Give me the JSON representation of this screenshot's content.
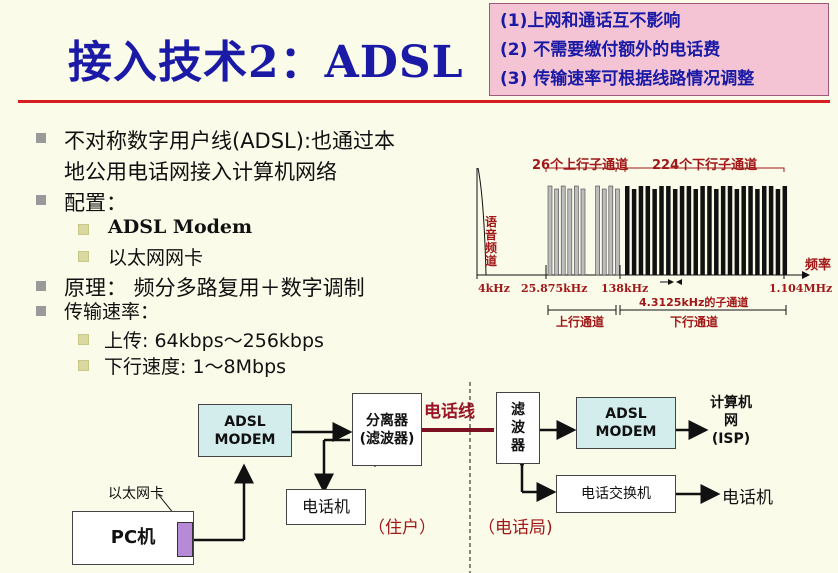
{
  "title": "接入技术2：ADSL",
  "callout": [
    "(1)上网和通话互不影响",
    "(2) 不需要缴付额外的电话费",
    "(3) 传输速率可根据线路情况调整"
  ],
  "bullets": {
    "adsl_line1": "不对称数字用户线(ADSL):也通过本",
    "adsl_line2": "地公用电话网接入计算机网络",
    "config": "配置：",
    "config_items": [
      "ADSL Modem",
      "以太网网卡"
    ],
    "principle": "原理：  频分多路复用＋数字调制",
    "rate": "传输速率：",
    "rate_items": [
      "上传: 64kbps～256kbps",
      "下行速度: 1～8Mbps"
    ]
  },
  "spectrum": {
    "voice_label": "语音频道",
    "up_channels_label": "26个上行子通道",
    "down_channels_label": "224个下行子通道",
    "axis_label": "频率",
    "ticks": [
      "4kHz",
      "25.875kHz",
      "138kHz",
      "1.104MHz"
    ],
    "subchannel_label": "4.3125kHz的子通道",
    "up_band_label": "上行通道",
    "down_band_label": "下行通道",
    "up_bar_count": 10,
    "down_bar_count": 24
  },
  "diagram": {
    "modem_left": "ADSL\nMODEM",
    "splitter": "分离器\n(滤波器)",
    "phone_line": "电话线",
    "filter": "滤\n波\n器",
    "modem_right": "ADSL\nMODEM",
    "network": "计算机\n网\n(ISP)",
    "phone_left": "电话机",
    "residence": "（住户）",
    "exchange": "电话交换机",
    "phone_right": "电话机",
    "office": "（电话局)",
    "nic": "以太网卡",
    "pc": "PC机"
  },
  "colors": {
    "title": "#1a1aa6",
    "rule": "#d62020",
    "callout_bg": "#f4c4d4",
    "label_red": "#a01818",
    "modem_cyan": "#d3ecec",
    "nic_purple": "#b68ad6"
  }
}
